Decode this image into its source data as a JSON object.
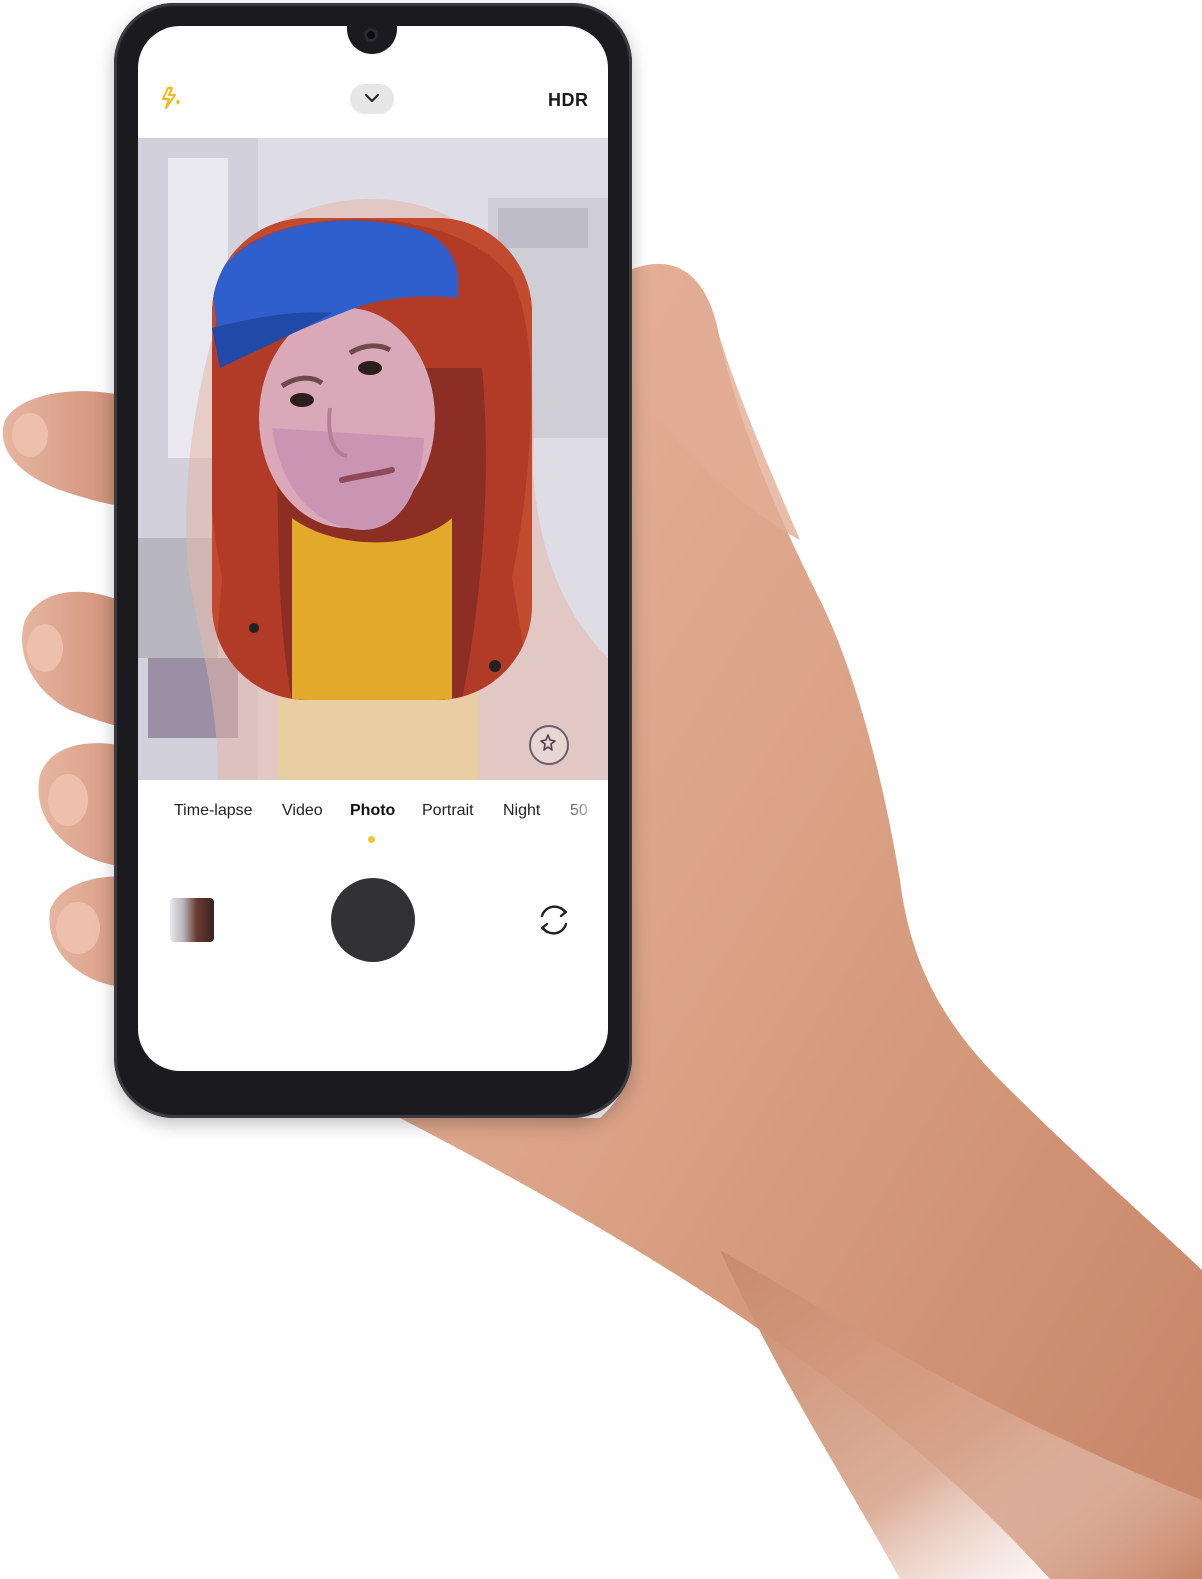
{
  "top_bar": {
    "flash_icon": "flash-auto-icon",
    "more_icon": "chevron-down-icon",
    "hdr_label": "HDR"
  },
  "modes": {
    "items": [
      "Time-lapse",
      "Video",
      "Photo",
      "Portrait",
      "Night",
      "50"
    ],
    "active": "Photo"
  },
  "controls": {
    "gallery_icon": "gallery-thumbnail",
    "shutter_icon": "shutter-icon",
    "switch_icon": "switch-camera-icon",
    "beauty_icon": "beauty-sparkle-icon"
  },
  "colors": {
    "accent": "#f4c430",
    "phone_frame": "#1b1b1f",
    "shutter": "#323235"
  }
}
